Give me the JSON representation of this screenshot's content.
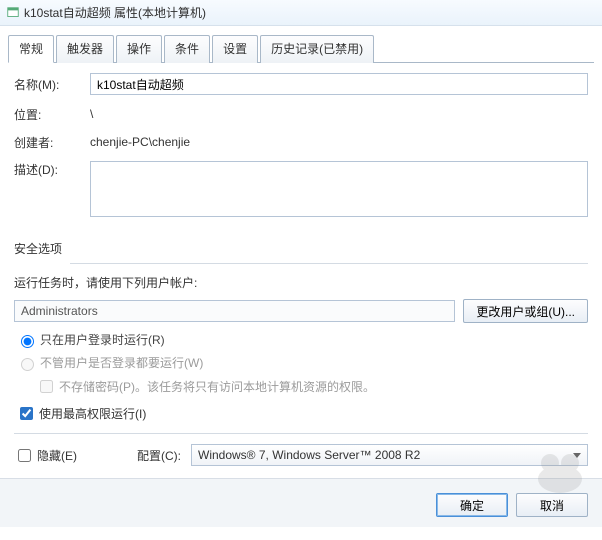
{
  "window": {
    "title": "k10stat自动超频 属性(本地计算机)"
  },
  "tabs": [
    {
      "label": "常规"
    },
    {
      "label": "触发器"
    },
    {
      "label": "操作"
    },
    {
      "label": "条件"
    },
    {
      "label": "设置"
    },
    {
      "label": "历史记录(已禁用)"
    }
  ],
  "general": {
    "name_label": "名称(M):",
    "name_value": "k10stat自动超频",
    "location_label": "位置:",
    "location_value": "\\",
    "author_label": "创建者:",
    "author_value": "chenjie-PC\\chenjie",
    "description_label": "描述(D):",
    "description_value": ""
  },
  "security": {
    "group_label": "安全选项",
    "instruction": "运行任务时，请使用下列用户帐户:",
    "account": "Administrators",
    "change_button": "更改用户或组(U)...",
    "radio_logged_on": "只在用户登录时运行(R)",
    "radio_any": "不管用户是否登录都要运行(W)",
    "nostore_password": "不存储密码(P)。该任务将只有访问本地计算机资源的权限。",
    "highest_priv": "使用最高权限运行(I)"
  },
  "bottom": {
    "hidden_label": "隐藏(E)",
    "config_label": "配置(C):",
    "config_value": "Windows® 7, Windows Server™ 2008 R2"
  },
  "buttons": {
    "ok": "确定",
    "cancel": "取消"
  }
}
